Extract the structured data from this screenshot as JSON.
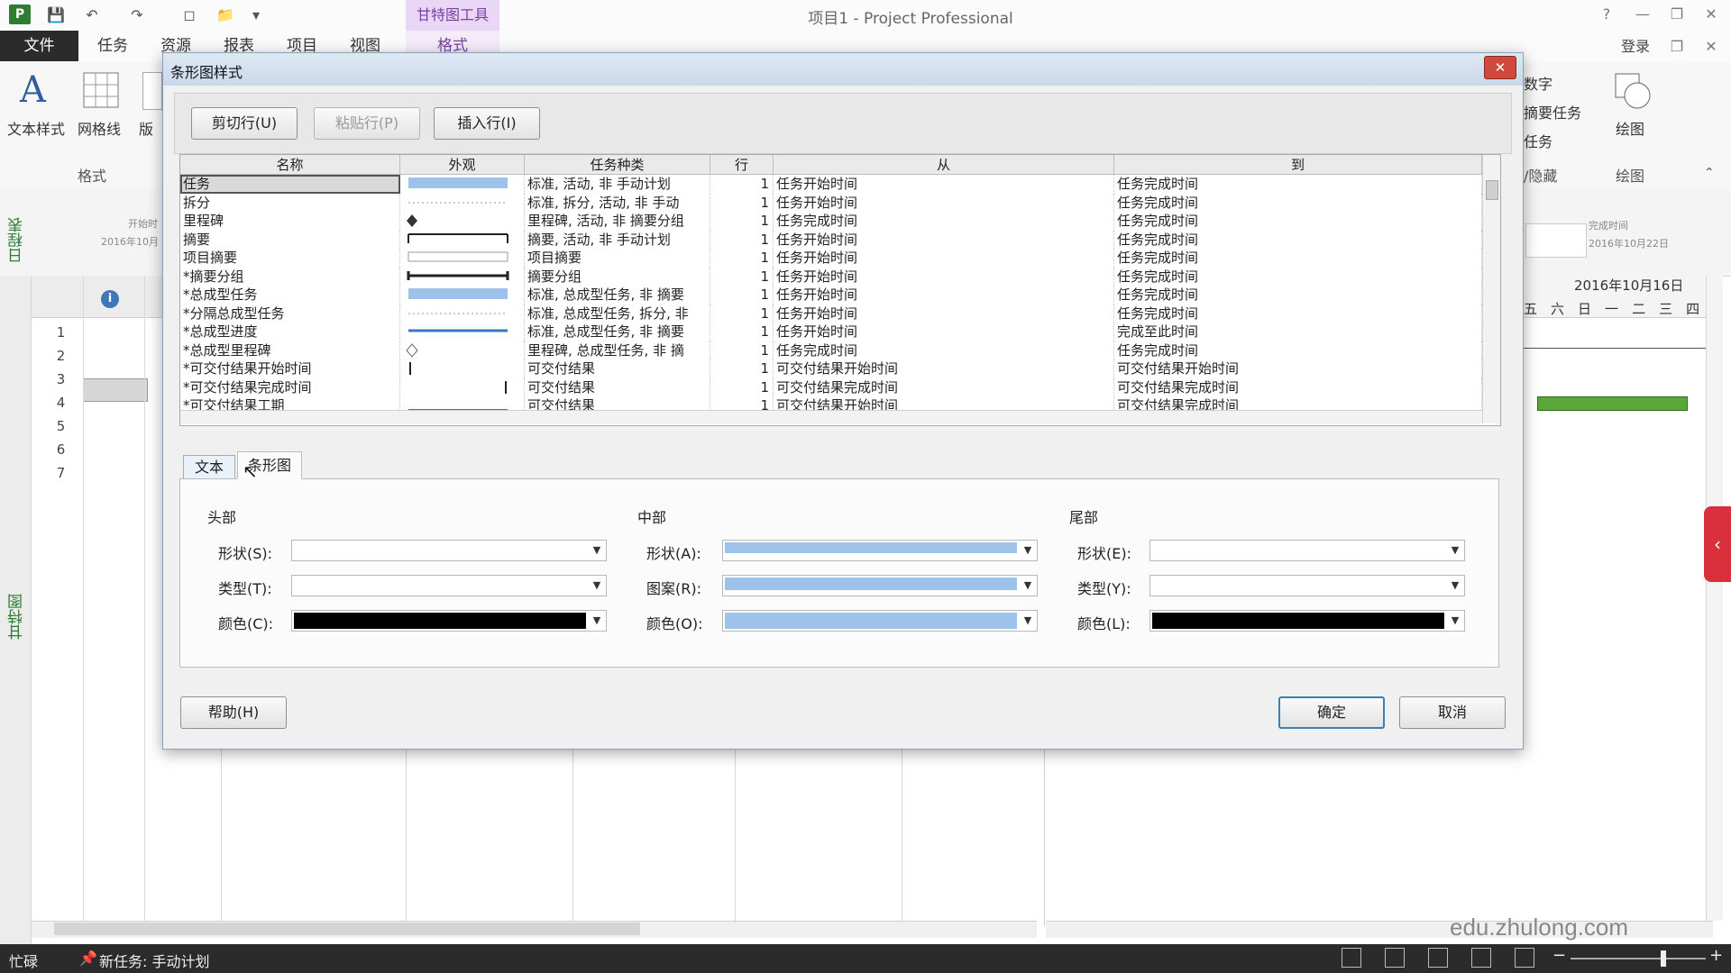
{
  "app": {
    "window_title": "项目1 - Project Professional",
    "contextual_tab_group": "甘特图工具",
    "login": "登录",
    "tabs": [
      "文件",
      "任务",
      "资源",
      "报表",
      "项目",
      "视图",
      "格式"
    ]
  },
  "ribbon": {
    "text_styles": "文本样式",
    "gridlines": "网格线",
    "layout_partial": "版",
    "group_format": "格式",
    "right_items": [
      "数字",
      "摘要任务",
      "任务"
    ],
    "show_hide": "/隐藏",
    "drawing": "绘图",
    "drawing_group": "绘图"
  },
  "timeline": {
    "label": "日程表",
    "start_label": "开始时",
    "start_date": "2016年10月",
    "finish_label": "完成时间",
    "finish_date": "2016年10月22日",
    "date_header": "2016年10月16日",
    "day_headers": [
      "五",
      "六",
      "日",
      "一",
      "二",
      "三",
      "四"
    ]
  },
  "sheet": {
    "info_icon": "info-icon",
    "row_numbers": [
      "1",
      "2",
      "3",
      "4",
      "5",
      "6",
      "7"
    ],
    "gantt_view_label": "甘特图"
  },
  "status": {
    "ready": "忙碌",
    "new_tasks": "新任务: 手动计划"
  },
  "watermark": "edu.zhulong.com",
  "dialog": {
    "title": "条形图样式",
    "buttons": {
      "cut_row": "剪切行(U)",
      "paste_row": "粘贴行(P)",
      "insert_row": "插入行(I)",
      "help": "帮助(H)",
      "ok": "确定",
      "cancel": "取消"
    },
    "columns": [
      "名称",
      "外观",
      "任务种类",
      "行",
      "从",
      "到"
    ],
    "rows": [
      {
        "name": "任务",
        "kind": "标准, 活动, 非 手动计划",
        "row": "1",
        "from": "任务开始时间",
        "to": "任务完成时间",
        "look": "bar-blue"
      },
      {
        "name": "拆分",
        "kind": "标准, 拆分, 活动, 非 手动",
        "row": "1",
        "from": "任务开始时间",
        "to": "任务完成时间",
        "look": "dotted"
      },
      {
        "name": "里程碑",
        "kind": "里程碑, 活动, 非 摘要分组",
        "row": "1",
        "from": "任务完成时间",
        "to": "任务完成时间",
        "look": "diamond"
      },
      {
        "name": "摘要",
        "kind": "摘要, 活动, 非 手动计划",
        "row": "1",
        "from": "任务开始时间",
        "to": "任务完成时间",
        "look": "bracket"
      },
      {
        "name": "项目摘要",
        "kind": "项目摘要",
        "row": "1",
        "from": "任务开始时间",
        "to": "任务完成时间",
        "look": "outline"
      },
      {
        "name": "*摘要分组",
        "kind": "摘要分组",
        "row": "1",
        "from": "任务开始时间",
        "to": "任务完成时间",
        "look": "thick-black"
      },
      {
        "name": "*总成型任务",
        "kind": "标准, 总成型任务, 非 摘要",
        "row": "1",
        "from": "任务开始时间",
        "to": "任务完成时间",
        "look": "bar-blue"
      },
      {
        "name": "*分隔总成型任务",
        "kind": "标准, 总成型任务, 拆分, 非",
        "row": "1",
        "from": "任务开始时间",
        "to": "任务完成时间",
        "look": "dotted"
      },
      {
        "name": "*总成型进度",
        "kind": "标准, 总成型任务, 非 摘要",
        "row": "1",
        "from": "任务开始时间",
        "to": "完成至此时间",
        "look": "line-blue"
      },
      {
        "name": "*总成型里程碑",
        "kind": "里程碑, 总成型任务, 非 摘",
        "row": "1",
        "from": "任务完成时间",
        "to": "任务完成时间",
        "look": "diamond-outline"
      },
      {
        "name": "*可交付结果开始时间",
        "kind": "可交付结果",
        "row": "1",
        "from": "可交付结果开始时间",
        "to": "可交付结果开始时间",
        "look": "tick-left"
      },
      {
        "name": "*可交付结果完成时间",
        "kind": "可交付结果",
        "row": "1",
        "from": "可交付结果完成时间",
        "to": "可交付结果完成时间",
        "look": "tick-right"
      },
      {
        "name": "*可交付结果工期",
        "kind": "可交付结果",
        "row": "1",
        "from": "可交付结果开始时间",
        "to": "可交付结果完成时间",
        "look": "line-purple"
      }
    ],
    "tabs": [
      "文本",
      "条形图"
    ],
    "sections": {
      "start": {
        "title": "头部",
        "shape_label": "形状(S):",
        "type_label": "类型(T):",
        "color_label": "颜色(C):"
      },
      "middle": {
        "title": "中部",
        "shape_label": "形状(A):",
        "pattern_label": "图案(R):",
        "color_label": "颜色(O):"
      },
      "end": {
        "title": "尾部",
        "shape_label": "形状(E):",
        "type_label": "类型(Y):",
        "color_label": "颜色(L):"
      }
    },
    "colors": {
      "start_color": "#000000",
      "middle_color": "#9dc3ea",
      "end_color": "#000000",
      "bar_blue": "#9dc3ea"
    }
  }
}
